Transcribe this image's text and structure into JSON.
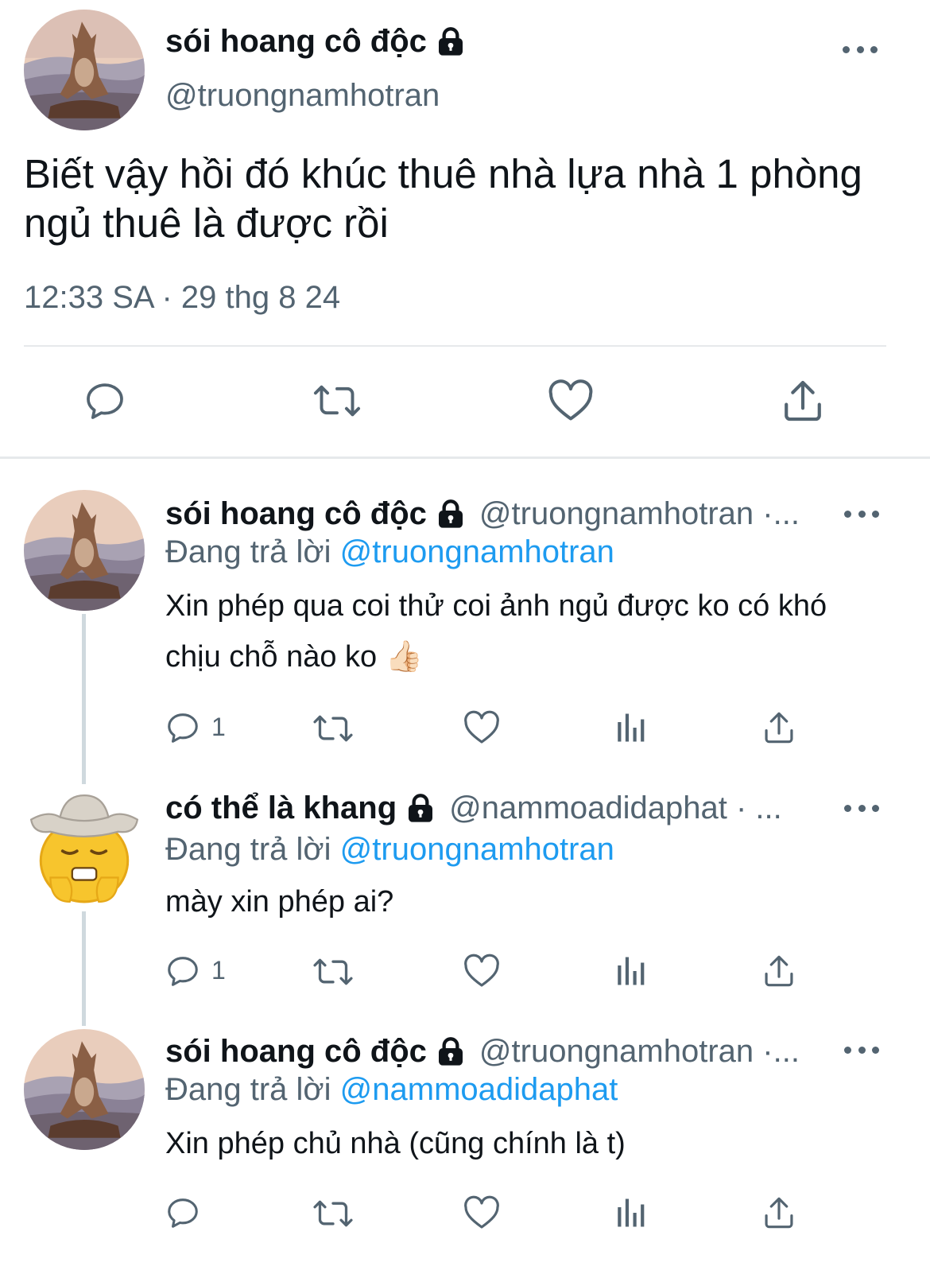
{
  "colors": {
    "text": "#0f1419",
    "secondary": "#536471",
    "link": "#1d9bf0",
    "divider": "#e6e9eb"
  },
  "main_tweet": {
    "name": "sói hoang cô độc",
    "handle": "@truongnamhotran",
    "text": "Biết vậy hồi đó khúc thuê nhà lựa nhà 1 phòng ngủ thuê là được rồi",
    "timestamp": "12:33 SA · 29 thg 8 24",
    "actions": [
      "reply-icon",
      "retweet-icon",
      "like-icon",
      "share-icon"
    ]
  },
  "replies": [
    {
      "name": "sói hoang cô độc",
      "handle": "@truongnamhotran ·...",
      "replying_label": "Đang trả lời",
      "replying_to": "@truongnamhotran",
      "text": "Xin phép qua coi thử coi ảnh ngủ được ko có khó chịu chỗ nào ko 👍🏻",
      "reply_count": "1"
    },
    {
      "name": "có thể là khang",
      "handle": "@nammoadidaphat · ...",
      "replying_label": "Đang trả lời",
      "replying_to": "@truongnamhotran",
      "text": "mày xin phép ai?",
      "reply_count": "1"
    },
    {
      "name": "sói hoang cô độc",
      "handle": "@truongnamhotran ·...",
      "replying_label": "Đang trả lời",
      "replying_to": "@nammoadidaphat",
      "text": "Xin phép chủ nhà (cũng chính là t)",
      "reply_count": ""
    }
  ]
}
